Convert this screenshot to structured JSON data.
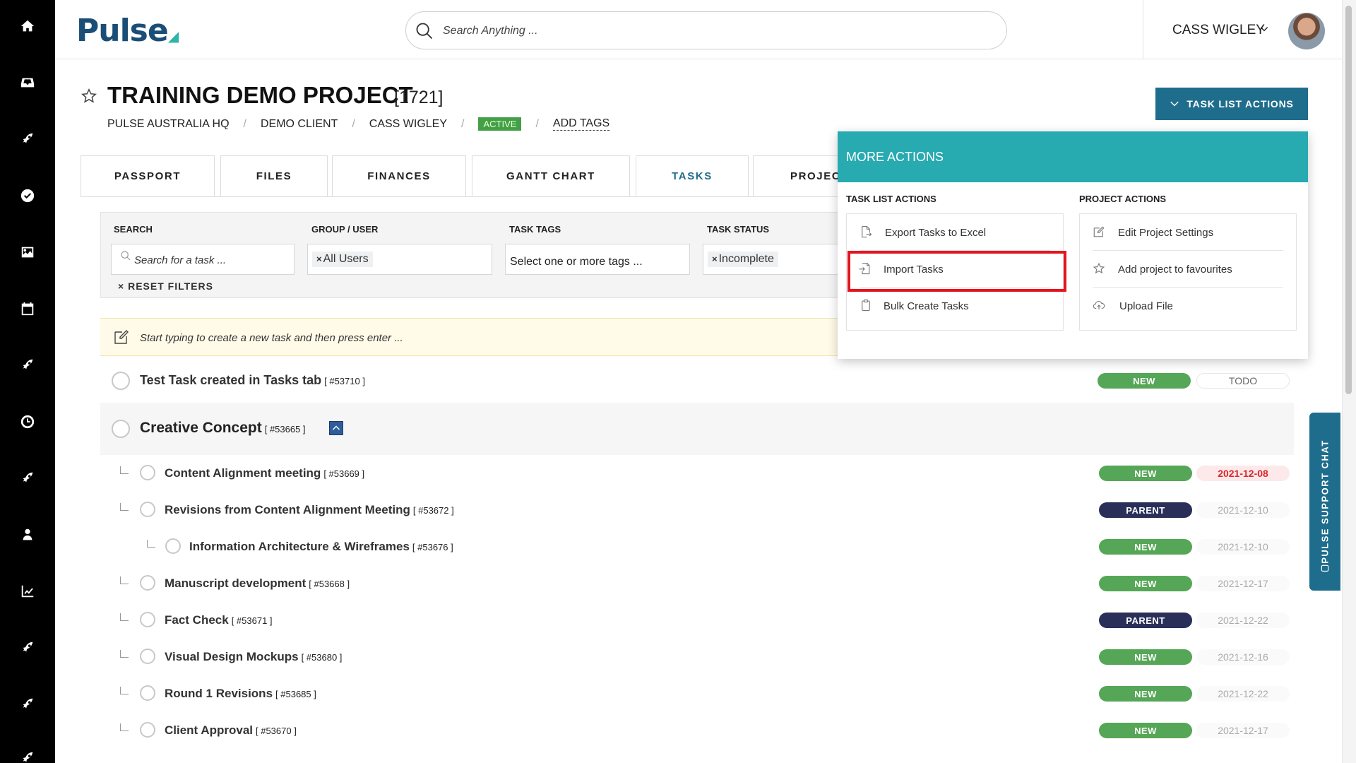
{
  "header": {
    "logo": "Pulse",
    "search_placeholder": "Search Anything ...",
    "user_name": "CASS WIGLEY"
  },
  "sidebar": {
    "items": [
      {
        "icon": "home-icon"
      },
      {
        "icon": "inbox-icon"
      },
      {
        "icon": "rocket-icon"
      },
      {
        "icon": "check-circle-icon"
      },
      {
        "icon": "image-icon"
      },
      {
        "icon": "calendar-icon"
      },
      {
        "icon": "rocket-icon"
      },
      {
        "icon": "clock-icon"
      },
      {
        "icon": "rocket-icon"
      },
      {
        "icon": "user-icon"
      },
      {
        "icon": "chart-line-icon"
      },
      {
        "icon": "rocket-icon"
      },
      {
        "icon": "rocket-icon"
      },
      {
        "icon": "rocket-icon"
      }
    ]
  },
  "project": {
    "title": "TRAINING DEMO PROJECT",
    "id": "[1721]",
    "breadcrumb": [
      "PULSE AUSTRALIA HQ",
      "DEMO CLIENT",
      "CASS WIGLEY"
    ],
    "status": "ACTIVE",
    "add_tags": "ADD TAGS",
    "task_list_actions_label": "TASK LIST ACTIONS"
  },
  "tabs": [
    "PASSPORT",
    "FILES",
    "FINANCES",
    "GANTT CHART",
    "TASKS",
    "PROJECT"
  ],
  "active_tab": "TASKS",
  "filters": {
    "search_label": "SEARCH",
    "search_placeholder": "Search for a task ...",
    "group_label": "GROUP / USER",
    "group_value": "All Users",
    "tags_label": "TASK TAGS",
    "tags_placeholder": "Select one or more tags ...",
    "status_label": "TASK STATUS",
    "status_value": "Incomplete",
    "reset_label": "RESET FILTERS"
  },
  "new_task_placeholder": "Start typing to create a new task and then press enter ...",
  "tasks": [
    {
      "name": "Test Task created in Tasks tab",
      "id": "[ #53710 ]",
      "status": "NEW",
      "date": "TODO"
    },
    {
      "name": "Creative Concept",
      "id": "[ #53665 ]"
    },
    {
      "name": "Content Alignment meeting",
      "id": "[ #53669 ]",
      "status": "NEW",
      "date": "2021-12-08"
    },
    {
      "name": "Revisions from Content Alignment Meeting",
      "id": "[ #53672 ]",
      "status": "PARENT",
      "date": "2021-12-10"
    },
    {
      "name": "Information Architecture & Wireframes",
      "id": "[ #53676 ]",
      "status": "NEW",
      "date": "2021-12-10"
    },
    {
      "name": "Manuscript development",
      "id": "[ #53668 ]",
      "status": "NEW",
      "date": "2021-12-17"
    },
    {
      "name": "Fact Check",
      "id": "[ #53671 ]",
      "status": "PARENT",
      "date": "2021-12-22"
    },
    {
      "name": "Visual Design Mockups",
      "id": "[ #53680 ]",
      "status": "NEW",
      "date": "2021-12-16"
    },
    {
      "name": "Round 1 Revisions",
      "id": "[ #53685 ]",
      "status": "NEW",
      "date": "2021-12-22"
    },
    {
      "name": "Client Approval",
      "id": "[ #53670 ]",
      "status": "NEW",
      "date": "2021-12-17"
    }
  ],
  "more_actions": {
    "title": "MORE ACTIONS",
    "task_list_title": "TASK LIST ACTIONS",
    "task_list_items": [
      "Export Tasks to Excel",
      "Import Tasks",
      "Bulk Create Tasks"
    ],
    "project_title": "PROJECT ACTIONS",
    "project_items": [
      "Edit Project Settings",
      "Add project to favourites",
      "Upload File"
    ]
  },
  "support_chat_label": "PULSE SUPPORT CHAT",
  "colors": {
    "brand": "#1b4e77",
    "accent": "#1f6d8c",
    "teal": "#27aab0",
    "new_badge": "#55a656",
    "parent_badge": "#2a2f5a",
    "overdue": "#d7272f",
    "highlight": "#e5141e"
  }
}
